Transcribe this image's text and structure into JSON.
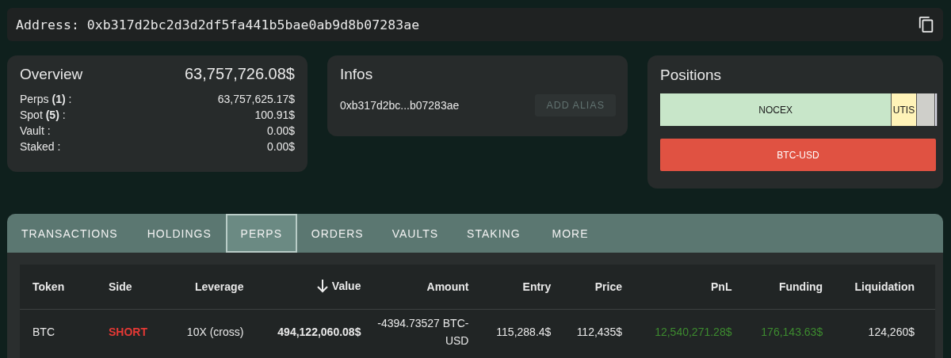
{
  "address_bar": {
    "label": "Address:",
    "address": "0xb317d2bc2d3d2df5fa441b5bae0ab9d8b07283ae"
  },
  "overview": {
    "title": "Overview",
    "total": "63,757,726.08$",
    "rows": [
      {
        "label": "Perps **(1)** :",
        "value": "63,757,625.17$"
      },
      {
        "label": "Spot **(5)** :",
        "value": "100.91$"
      },
      {
        "label": "Vault :",
        "value": "0.00$"
      },
      {
        "label": "Staked :",
        "value": "0.00$"
      }
    ]
  },
  "infos": {
    "title": "Infos",
    "short_address": "0xb317d2bc...b07283ae",
    "button": "ADD ALIAS"
  },
  "positions": {
    "title": "Positions",
    "segments": [
      {
        "label": "NOCEX",
        "color": "#c8e6c9"
      },
      {
        "label": "UTIS",
        "color": "#fff3b8"
      },
      {
        "color": "#cfcfca"
      },
      {
        "color": "#dcdce8"
      }
    ],
    "bars": [
      {
        "label": "BTC-USD",
        "color": "#e05242"
      }
    ]
  },
  "tabs": [
    {
      "label": "TRANSACTIONS",
      "selected": false
    },
    {
      "label": "HOLDINGS",
      "selected": false
    },
    {
      "label": "PERPS",
      "selected": true
    },
    {
      "label": "ORDERS",
      "selected": false
    },
    {
      "label": "VAULTS",
      "selected": false
    },
    {
      "label": "STAKING",
      "selected": false
    },
    {
      "label": "MORE",
      "selected": false
    }
  ],
  "table": {
    "columns": [
      {
        "label": "Token",
        "sorted": false
      },
      {
        "label": "Side",
        "sorted": false
      },
      {
        "label": "Leverage",
        "sorted": false
      },
      {
        "label": "Value",
        "sorted": true
      },
      {
        "label": "Amount",
        "sorted": false
      },
      {
        "label": "Entry",
        "sorted": false
      },
      {
        "label": "Price",
        "sorted": false
      },
      {
        "label": "PnL",
        "sorted": false
      },
      {
        "label": "Funding",
        "sorted": false
      },
      {
        "label": "Liquidation",
        "sorted": false
      }
    ],
    "rows": [
      [
        {
          "text": "BTC",
          "kind": "plain"
        },
        {
          "text": "SHORT",
          "kind": "short"
        },
        {
          "text": "10X (cross)",
          "kind": "plain"
        },
        {
          "text": "494,122,060.08$",
          "kind": "bold"
        },
        {
          "text": "-4394.73527 BTC-USD",
          "kind": "plain"
        },
        {
          "text": "115,288.4$",
          "kind": "plain"
        },
        {
          "text": "112,435$",
          "kind": "plain"
        },
        {
          "text": "12,540,271.28$",
          "kind": "gain"
        },
        {
          "text": "176,143.63$",
          "kind": "gain"
        },
        {
          "text": "124,260$",
          "kind": "plain"
        }
      ]
    ]
  }
}
